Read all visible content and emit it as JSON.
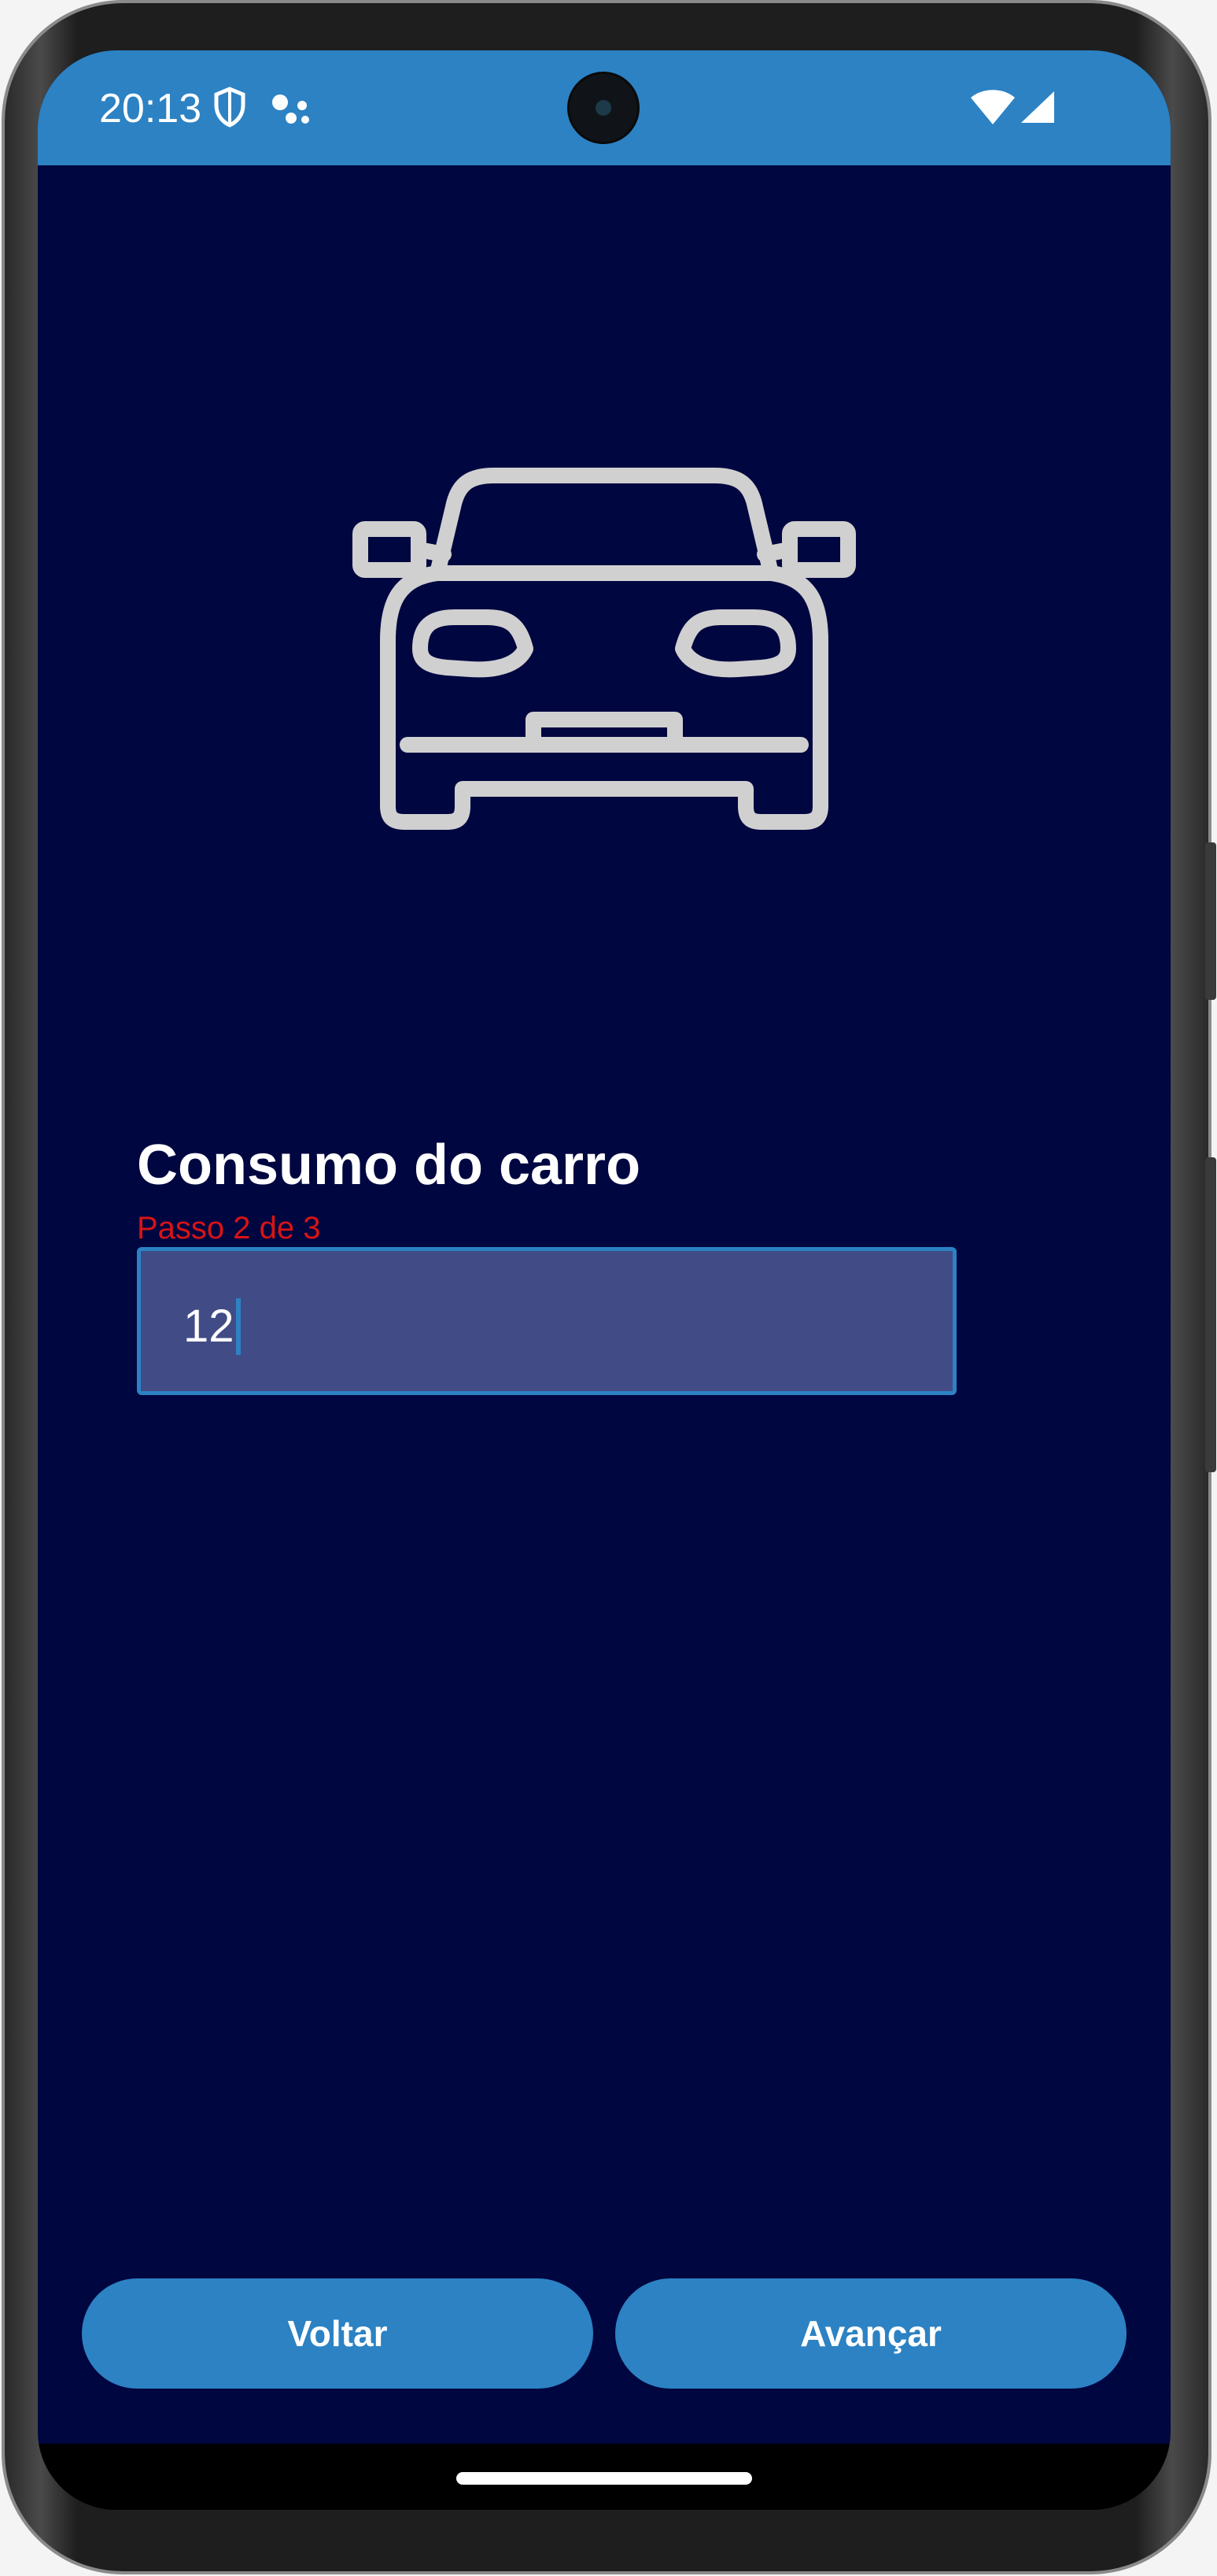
{
  "status_bar": {
    "time": "20:13",
    "icons": [
      "shield-icon",
      "assistant-dots-icon",
      "wifi-icon",
      "signal-icon"
    ],
    "background_color": "#2c82c3"
  },
  "hero": {
    "icon": "car-icon",
    "icon_color": "#d0d0d0"
  },
  "form": {
    "title": "Consumo do carro",
    "step_text": "Passo 2 de 3",
    "step_color": "#d81414",
    "input_value": "12"
  },
  "actions": {
    "back_label": "Voltar",
    "next_label": "Avançar",
    "button_color": "#2c82c3"
  },
  "theme": {
    "background": "#000640",
    "input_background": "#414c86"
  }
}
